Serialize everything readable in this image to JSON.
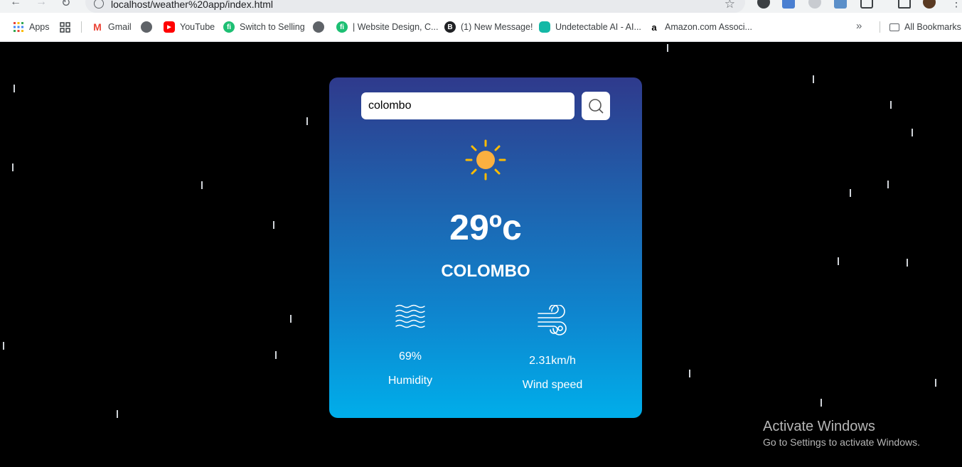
{
  "browser": {
    "url": "localhost/weather%20app/index.html",
    "bookmarks": [
      {
        "label": "Apps",
        "icon": "apps-grid-icon"
      },
      {
        "label": "",
        "icon": "tab-groups-icon"
      },
      {
        "label": "Gmail",
        "icon": "gmail-icon"
      },
      {
        "label": "",
        "icon": "globe-icon"
      },
      {
        "label": "YouTube",
        "icon": "youtube-icon"
      },
      {
        "label": "Switch to Selling",
        "icon": "fiverr-icon"
      },
      {
        "label": "",
        "icon": "globe-icon"
      },
      {
        "label": "| Website Design, C...",
        "icon": "fiverr-icon"
      },
      {
        "label": "(1) New Message!",
        "icon": "b-icon"
      },
      {
        "label": "Undetectable AI - AI...",
        "icon": "undetectable-icon"
      },
      {
        "label": "Amazon.com Associ...",
        "icon": "amazon-icon"
      }
    ],
    "all_bookmarks": "All Bookmarks"
  },
  "weather": {
    "search_value": "colombo",
    "temperature": "29ºc",
    "city": "COLOMBO",
    "humidity_value": "69%",
    "humidity_label": "Humidity",
    "wind_value": "2.31km/h",
    "wind_label": "Wind speed",
    "condition_icon": "sun-icon"
  },
  "os_watermark": {
    "title": "Activate Windows",
    "subtitle": "Go to Settings to activate Windows."
  },
  "colors": {
    "card_top": "#2f3a8c",
    "card_bottom": "#00aeea",
    "sun": "#fbb040"
  }
}
